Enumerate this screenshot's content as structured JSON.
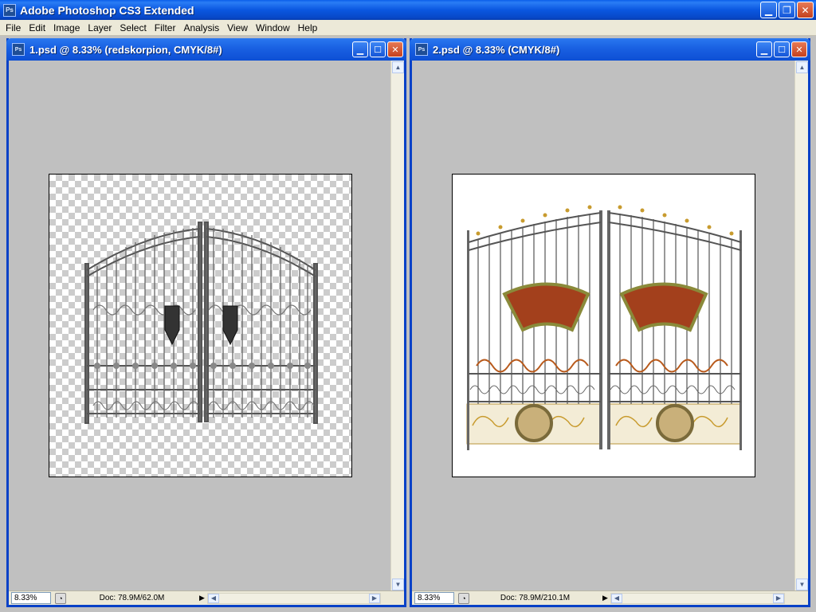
{
  "app": {
    "icon": "Ps",
    "title": "Adobe Photoshop CS3 Extended"
  },
  "menu": [
    "File",
    "Edit",
    "Image",
    "Layer",
    "Select",
    "Filter",
    "Analysis",
    "View",
    "Window",
    "Help"
  ],
  "windows": [
    {
      "title": "1.psd @ 8.33% (redskorpion, CMYK/8#)",
      "icon": "Ps",
      "zoom": "8.33%",
      "doc": "Doc: 78.9M/62.0M",
      "background": "transparent-checker"
    },
    {
      "title": "2.psd @ 8.33% (CMYK/8#)",
      "icon": "Ps",
      "zoom": "8.33%",
      "doc": "Doc: 78.9M/210.1M",
      "background": "white"
    }
  ],
  "colors": {
    "titlebar": "#0a57e0",
    "gate_gray": "#555555",
    "gate_gold": "#c89b2e",
    "panel_red": "#a3401c",
    "medallion": "#c9b07a"
  }
}
